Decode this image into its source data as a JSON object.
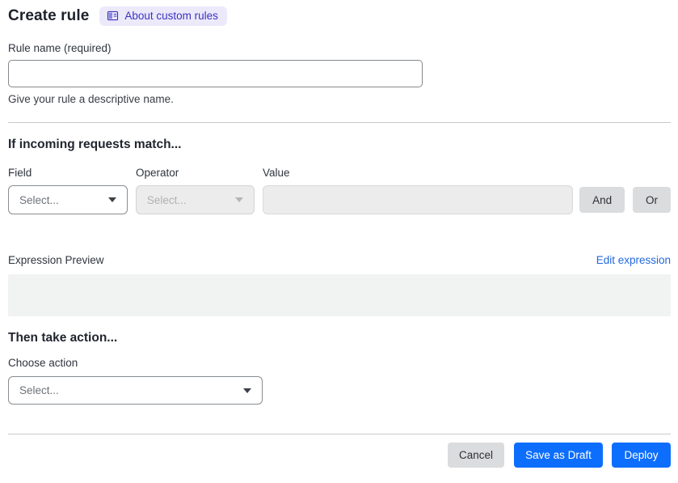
{
  "header": {
    "title": "Create rule",
    "about_badge_label": "About custom rules"
  },
  "rule_name": {
    "label": "Rule name (required)",
    "value": "",
    "placeholder": "",
    "helper": "Give your rule a descriptive name."
  },
  "match_section": {
    "heading": "If incoming requests match...",
    "field_label": "Field",
    "operator_label": "Operator",
    "value_label": "Value",
    "field_select_value": "Select...",
    "operator_select_value": "Select...",
    "value_input_value": "",
    "and_button_label": "And",
    "or_button_label": "Or"
  },
  "expression": {
    "label": "Expression Preview",
    "edit_link_label": "Edit expression",
    "preview_content": ""
  },
  "action_section": {
    "heading": "Then take action...",
    "choose_label": "Choose action",
    "action_select_value": "Select..."
  },
  "footer": {
    "cancel_label": "Cancel",
    "save_draft_label": "Save as Draft",
    "deploy_label": "Deploy"
  },
  "colors": {
    "primary_blue": "#0d6efd",
    "link_blue": "#2268dd",
    "badge_bg": "#ece9fb",
    "badge_text": "#3c33c0",
    "disabled_bg": "#ececec",
    "gray_button_bg": "#dbdcdd"
  }
}
